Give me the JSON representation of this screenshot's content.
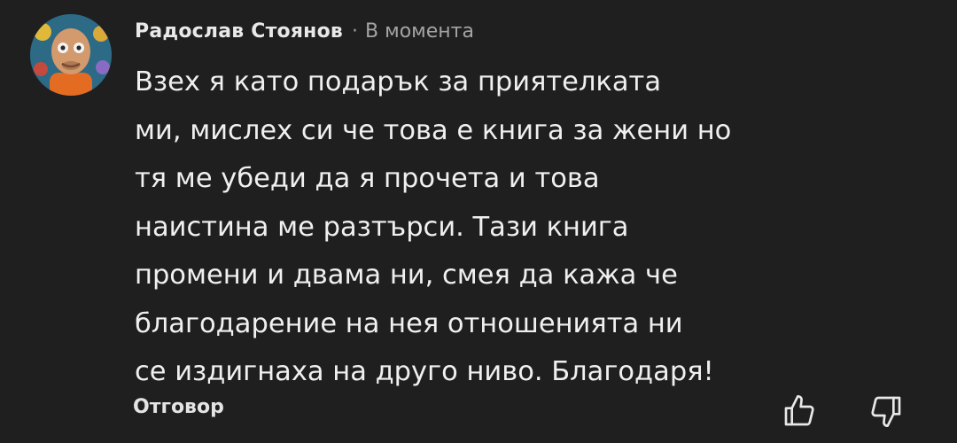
{
  "comment": {
    "author": "Радослав Стоянов",
    "separator": "·",
    "time": "В момента",
    "lines": [
      "Взех я като подарък за приятелката",
      "ми, мислех си че това е книга за жени но",
      "тя ме убеди да я прочета и това",
      "наистина ме разтърси. Тази книга",
      "промени и двама ни, смея да кажа че",
      "благодарение на нея отношенията ни",
      "се издигнаха на друго ниво. Благодаря!"
    ]
  },
  "actions": {
    "reply_label": "Отговор",
    "like_icon": "thumbs-up-icon",
    "dislike_icon": "thumbs-down-icon"
  },
  "colors": {
    "background": "#1f1f1f",
    "text": "#f0f0f0",
    "muted": "#a4a4a4"
  }
}
